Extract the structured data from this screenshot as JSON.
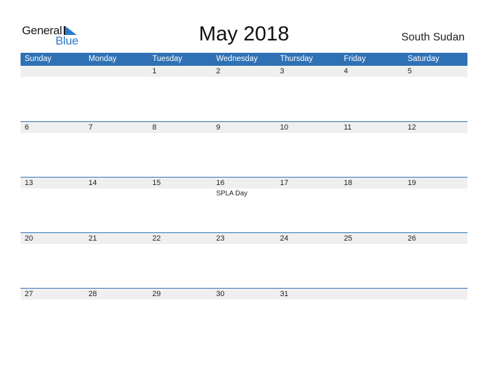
{
  "logo": {
    "word1": "General",
    "word2": "Blue"
  },
  "title": "May 2018",
  "country": "South Sudan",
  "colors": {
    "accent": "#2e71b5",
    "band": "#efefef",
    "logo_blue": "#2a7ac9"
  },
  "weekdays": [
    "Sunday",
    "Monday",
    "Tuesday",
    "Wednesday",
    "Thursday",
    "Friday",
    "Saturday"
  ],
  "weeks": [
    {
      "days": [
        "",
        "",
        "1",
        "2",
        "3",
        "4",
        "5"
      ],
      "events": [
        "",
        "",
        "",
        "",
        "",
        "",
        ""
      ]
    },
    {
      "days": [
        "6",
        "7",
        "8",
        "9",
        "10",
        "11",
        "12"
      ],
      "events": [
        "",
        "",
        "",
        "",
        "",
        "",
        ""
      ]
    },
    {
      "days": [
        "13",
        "14",
        "15",
        "16",
        "17",
        "18",
        "19"
      ],
      "events": [
        "",
        "",
        "",
        "SPLA Day",
        "",
        "",
        ""
      ]
    },
    {
      "days": [
        "20",
        "21",
        "22",
        "23",
        "24",
        "25",
        "26"
      ],
      "events": [
        "",
        "",
        "",
        "",
        "",
        "",
        ""
      ]
    },
    {
      "days": [
        "27",
        "28",
        "29",
        "30",
        "31",
        "",
        ""
      ],
      "events": [
        "",
        "",
        "",
        "",
        "",
        "",
        ""
      ]
    }
  ]
}
